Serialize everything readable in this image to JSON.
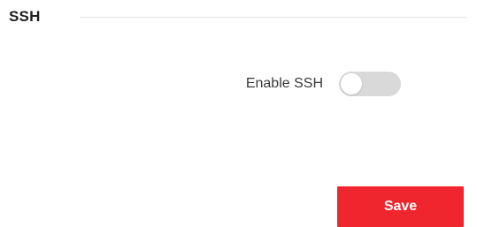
{
  "section": {
    "title": "SSH"
  },
  "ssh_setting": {
    "label": "Enable SSH",
    "enabled": false,
    "toggle_off_color": "#d9d9d9"
  },
  "actions": {
    "save_label": "Save",
    "save_color": "#f0262e"
  }
}
